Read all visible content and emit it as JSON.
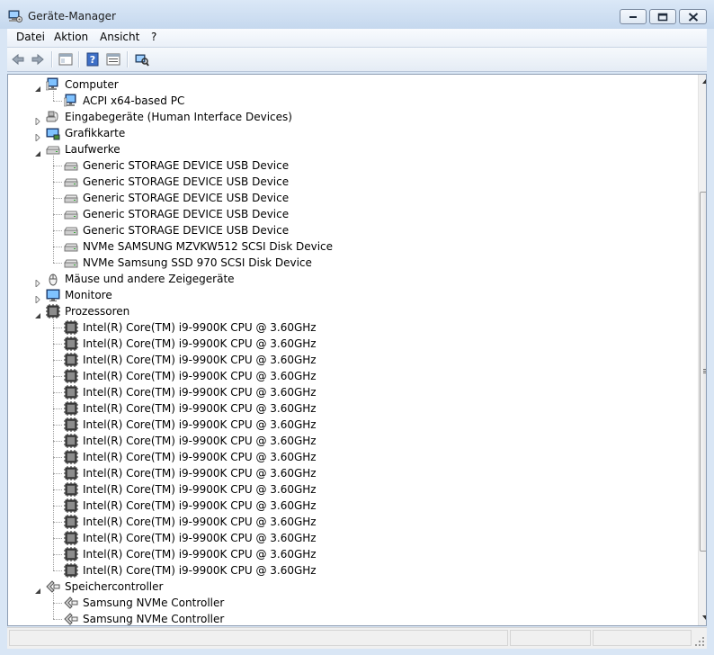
{
  "window": {
    "title": "Geräte-Manager",
    "icon": "device-manager-icon"
  },
  "menu": {
    "items": [
      "Datei",
      "Aktion",
      "Ansicht",
      "?"
    ]
  },
  "toolbar": {
    "buttons": [
      "back-arrow-icon",
      "forward-arrow-icon",
      "show-hide-console-tree-icon",
      "help-icon",
      "properties-icon",
      "scan-hardware-icon"
    ]
  },
  "tree": {
    "nodes": [
      {
        "label": "Computer",
        "level": 0,
        "expanded": true,
        "icon": "computer-icon"
      },
      {
        "label": "ACPI x64-based PC",
        "level": 1,
        "icon": "computer-icon"
      },
      {
        "label": "Eingabegeräte (Human Interface Devices)",
        "level": 0,
        "expanded": false,
        "icon": "hid-icon"
      },
      {
        "label": "Grafikkarte",
        "level": 0,
        "expanded": false,
        "icon": "display-adapter-icon"
      },
      {
        "label": "Laufwerke",
        "level": 0,
        "expanded": true,
        "icon": "disk-drive-icon"
      },
      {
        "label": "Generic STORAGE DEVICE USB Device",
        "level": 1,
        "icon": "disk-drive-icon"
      },
      {
        "label": "Generic STORAGE DEVICE USB Device",
        "level": 1,
        "icon": "disk-drive-icon"
      },
      {
        "label": "Generic STORAGE DEVICE USB Device",
        "level": 1,
        "icon": "disk-drive-icon"
      },
      {
        "label": "Generic STORAGE DEVICE USB Device",
        "level": 1,
        "icon": "disk-drive-icon"
      },
      {
        "label": "Generic STORAGE DEVICE USB Device",
        "level": 1,
        "icon": "disk-drive-icon"
      },
      {
        "label": "NVMe SAMSUNG MZVKW512 SCSI Disk Device",
        "level": 1,
        "icon": "disk-drive-icon"
      },
      {
        "label": "NVMe Samsung SSD 970 SCSI Disk Device",
        "level": 1,
        "icon": "disk-drive-icon"
      },
      {
        "label": "Mäuse und andere Zeigegeräte",
        "level": 0,
        "expanded": false,
        "icon": "mouse-icon"
      },
      {
        "label": "Monitore",
        "level": 0,
        "expanded": false,
        "icon": "monitor-icon"
      },
      {
        "label": "Prozessoren",
        "level": 0,
        "expanded": true,
        "icon": "processor-icon"
      },
      {
        "label": "Intel(R) Core(TM) i9-9900K CPU @ 3.60GHz",
        "level": 1,
        "icon": "processor-icon"
      },
      {
        "label": "Intel(R) Core(TM) i9-9900K CPU @ 3.60GHz",
        "level": 1,
        "icon": "processor-icon"
      },
      {
        "label": "Intel(R) Core(TM) i9-9900K CPU @ 3.60GHz",
        "level": 1,
        "icon": "processor-icon"
      },
      {
        "label": "Intel(R) Core(TM) i9-9900K CPU @ 3.60GHz",
        "level": 1,
        "icon": "processor-icon"
      },
      {
        "label": "Intel(R) Core(TM) i9-9900K CPU @ 3.60GHz",
        "level": 1,
        "icon": "processor-icon"
      },
      {
        "label": "Intel(R) Core(TM) i9-9900K CPU @ 3.60GHz",
        "level": 1,
        "icon": "processor-icon"
      },
      {
        "label": "Intel(R) Core(TM) i9-9900K CPU @ 3.60GHz",
        "level": 1,
        "icon": "processor-icon"
      },
      {
        "label": "Intel(R) Core(TM) i9-9900K CPU @ 3.60GHz",
        "level": 1,
        "icon": "processor-icon"
      },
      {
        "label": "Intel(R) Core(TM) i9-9900K CPU @ 3.60GHz",
        "level": 1,
        "icon": "processor-icon"
      },
      {
        "label": "Intel(R) Core(TM) i9-9900K CPU @ 3.60GHz",
        "level": 1,
        "icon": "processor-icon"
      },
      {
        "label": "Intel(R) Core(TM) i9-9900K CPU @ 3.60GHz",
        "level": 1,
        "icon": "processor-icon"
      },
      {
        "label": "Intel(R) Core(TM) i9-9900K CPU @ 3.60GHz",
        "level": 1,
        "icon": "processor-icon"
      },
      {
        "label": "Intel(R) Core(TM) i9-9900K CPU @ 3.60GHz",
        "level": 1,
        "icon": "processor-icon"
      },
      {
        "label": "Intel(R) Core(TM) i9-9900K CPU @ 3.60GHz",
        "level": 1,
        "icon": "processor-icon"
      },
      {
        "label": "Intel(R) Core(TM) i9-9900K CPU @ 3.60GHz",
        "level": 1,
        "icon": "processor-icon"
      },
      {
        "label": "Intel(R) Core(TM) i9-9900K CPU @ 3.60GHz",
        "level": 1,
        "icon": "processor-icon"
      },
      {
        "label": "Speichercontroller",
        "level": 0,
        "expanded": true,
        "icon": "storage-controller-icon"
      },
      {
        "label": "Samsung NVMe Controller",
        "level": 1,
        "icon": "storage-controller-icon"
      },
      {
        "label": "Samsung NVMe Controller",
        "level": 1,
        "icon": "storage-controller-icon"
      }
    ]
  },
  "colors": {
    "window_frame": "#d9e6f5",
    "tree_background": "#ffffff",
    "status_background": "#f0f0f0"
  }
}
